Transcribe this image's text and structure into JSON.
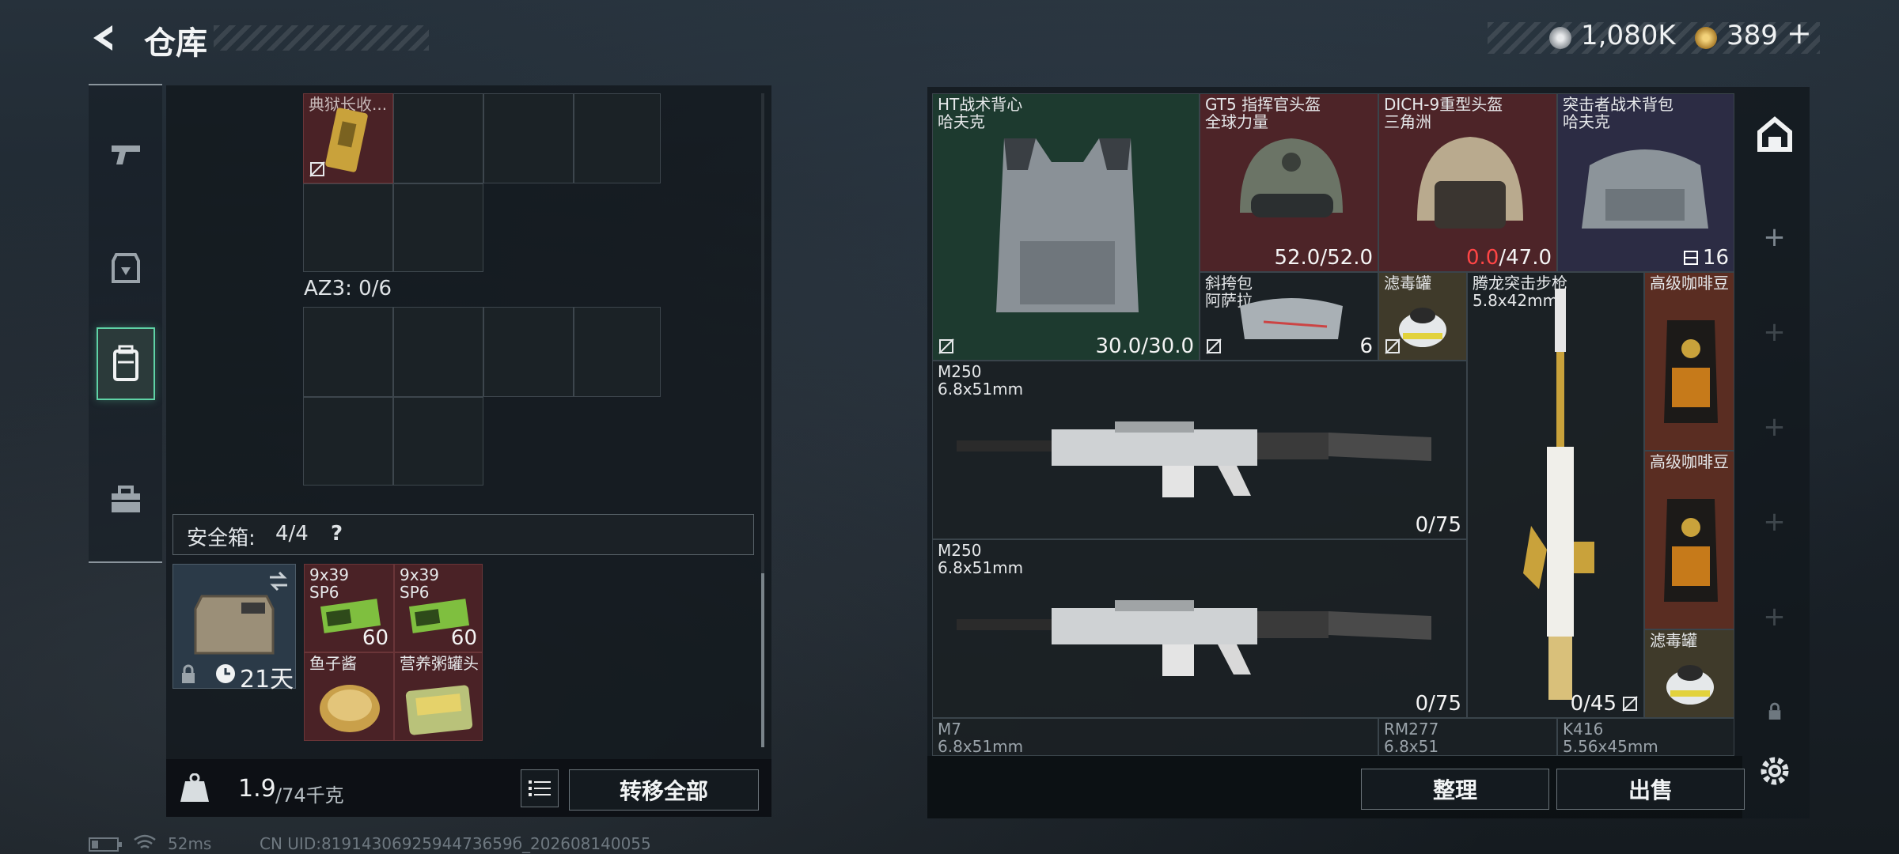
{
  "header": {
    "title": "仓库"
  },
  "currency": [
    {
      "icon": "silver-coin-icon",
      "amount": "1,080K"
    },
    {
      "icon": "gold-triangle-coin-icon",
      "amount": "389"
    }
  ],
  "nav": [
    {
      "id": "weapons",
      "icon": "pistol-icon"
    },
    {
      "id": "equipment",
      "icon": "helmet-icon"
    },
    {
      "id": "backpack",
      "icon": "backpack-icon",
      "active": true
    },
    {
      "id": "toolbox",
      "icon": "toolbox-icon"
    }
  ],
  "left": {
    "item1": {
      "name": "典狱长收...",
      "color": "red"
    },
    "container_label": "AZ3: 0/6",
    "safe_box": {
      "label": "安全箱:",
      "count": "4/4",
      "help": "?",
      "timer": "21天"
    },
    "safe_items": [
      {
        "name": "9x39",
        "sub": "SP6",
        "count": "60"
      },
      {
        "name": "9x39",
        "sub": "SP6",
        "count": "60"
      },
      {
        "name": "鱼子酱",
        "sub": ""
      },
      {
        "name": "营养粥罐头",
        "sub": ""
      }
    ],
    "weight": {
      "value": "1.9",
      "max": "/74千克",
      "kg_label": "KG"
    },
    "transfer_all": "转移全部"
  },
  "right": {
    "items": [
      {
        "key": "vest",
        "name": "HT战术背心",
        "sub": "哈夫克",
        "count": "30.0/30.0"
      },
      {
        "key": "helmet1",
        "name": "GT5 指挥官头盔",
        "sub": "全球力量",
        "count": "52.0/52.0"
      },
      {
        "key": "helmet2",
        "name": "DICH-9重型头盔",
        "sub": "三角洲",
        "count_red": "0.0",
        "count_rest": "/47.0"
      },
      {
        "key": "bag",
        "name": "突击者战术背包",
        "sub": "哈夫克",
        "count": "16"
      },
      {
        "key": "sling",
        "name": "斜挎包",
        "sub": "阿萨拉",
        "count": "6"
      },
      {
        "key": "filter1",
        "name": "滤毒罐",
        "sub": ""
      },
      {
        "key": "rifle",
        "name": "腾龙突击步枪",
        "sub": "5.8x42mm",
        "count": "0/45"
      },
      {
        "key": "coffee1",
        "name": "高级咖啡豆",
        "sub": ""
      },
      {
        "key": "m250a",
        "name": "M250",
        "sub": "6.8x51mm",
        "count": "0/75"
      },
      {
        "key": "coffee2",
        "name": "高级咖啡豆",
        "sub": ""
      },
      {
        "key": "m250b",
        "name": "M250",
        "sub": "6.8x51mm",
        "count": "0/75"
      },
      {
        "key": "filter2",
        "name": "滤毒罐",
        "sub": ""
      },
      {
        "key": "m7",
        "name": "M7",
        "sub": "6.8x51mm"
      },
      {
        "key": "rm277",
        "name": "RM277",
        "sub": "6.8x51"
      },
      {
        "key": "k416",
        "name": "K416",
        "sub": "5.56x45mm"
      }
    ],
    "organize": "整理",
    "sell": "出售"
  },
  "status": {
    "ping": "52ms",
    "uid": "CN UID:8191430692594473659б_202608140055"
  }
}
